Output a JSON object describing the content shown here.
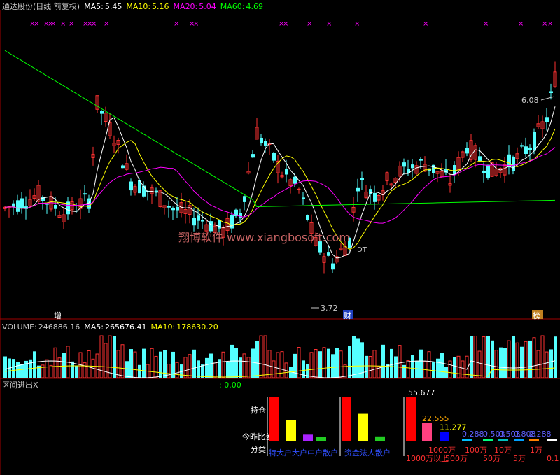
{
  "price_header": {
    "name": "通达股份(日线 前复权)",
    "ma5_label": "MA5:",
    "ma5_value": "5.45",
    "ma10_label": "MA10:",
    "ma10_value": "5.16",
    "ma20_label": "MA20:",
    "ma20_value": "5.04",
    "ma60_label": "MA60:",
    "ma60_value": "4.69"
  },
  "volume_header": {
    "volume_label": "VOLUME:",
    "volume_value": "246886.16",
    "ma5_label": "MA5:",
    "ma5_value": "265676.41",
    "ma10_label": "MA10:",
    "ma10_value": "178630.20"
  },
  "indicator_header": {
    "name": "区间进出X",
    "value": ": 0.00"
  },
  "watermark": "翔博软件 www.xiangbosoft.com",
  "markers": {
    "zeng": "增",
    "cai": "财",
    "bang": "榜"
  },
  "price_annotations": {
    "high": "6.08",
    "low": "3.72",
    "dt": "DT"
  },
  "colors": {
    "up": "#ff3232",
    "down": "#54ffff",
    "ma5": "#ffffff",
    "ma10": "#ffff00",
    "ma20": "#ff00ff",
    "ma60": "#00ff00",
    "grid": "#a00000",
    "bg": "#000000"
  },
  "chart_data": [
    {
      "type": "candlestick",
      "title": "通达股份(日线 前复权)",
      "annotated_high": 6.08,
      "annotated_low": 3.72,
      "series": [
        {
          "name": "MA5",
          "last": 5.45
        },
        {
          "name": "MA10",
          "last": 5.16
        },
        {
          "name": "MA20",
          "last": 5.04
        },
        {
          "name": "MA60",
          "last": 4.69
        }
      ],
      "ylim": [
        3.5,
        6.6
      ]
    },
    {
      "type": "bar",
      "title": "VOLUME",
      "series": [
        {
          "name": "VOLUME",
          "last": 246886.16
        },
        {
          "name": "MA5",
          "last": 265676.41
        },
        {
          "name": "MA10",
          "last": 178630.2
        }
      ]
    },
    {
      "type": "bar",
      "title": "区间进出X",
      "row_labels": [
        "持仓:",
        "今昨比差:",
        "分类:"
      ],
      "groups": [
        {
          "categories": [
            "特大户",
            "大户",
            "中户",
            "散户"
          ],
          "colors": [
            "#ff0000",
            "#ffff00",
            "#aa22ff",
            "#22cc22"
          ],
          "values": [
            100,
            48,
            14,
            9
          ]
        },
        {
          "categories": [
            "资金",
            "法人",
            "散户"
          ],
          "colors": [
            "#ff0000",
            "#ffff00",
            "#22cc22"
          ],
          "values": [
            100,
            62,
            10
          ]
        },
        {
          "categories": [
            "1000万以上",
            "1000万",
            "500万",
            "100万",
            "50万",
            "10万",
            "5万",
            "1万",
            "0.1"
          ],
          "value_labels": [
            "55.677",
            "22.555",
            "11.277",
            "0.288",
            "0.503",
            "0.503",
            "0.808",
            "2.288",
            ""
          ],
          "values": [
            55.677,
            22.555,
            11.277,
            0.288,
            0.503,
            0.503,
            0.808,
            2.288,
            1.0
          ]
        }
      ]
    }
  ]
}
